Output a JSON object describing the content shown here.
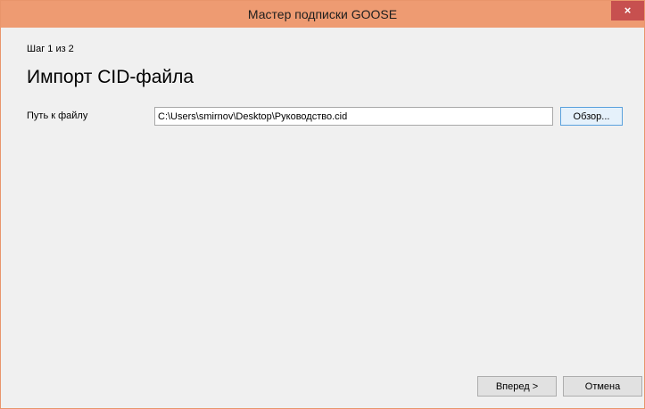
{
  "window": {
    "title": "Мастер подписки GOOSE",
    "close_glyph": "×"
  },
  "wizard": {
    "step": "Шаг 1 из 2",
    "heading": "Импорт CID-файла",
    "file_path_label": "Путь к файлу",
    "file_path_value": "C:\\Users\\smirnov\\Desktop\\Руководство.cid",
    "browse_label": "Обзор..."
  },
  "footer": {
    "next_label": "Вперед >",
    "cancel_label": "Отмена"
  },
  "colors": {
    "titlebar": "#ee9b72",
    "close_button": "#c7504f",
    "dialog_background": "#f0f0f0"
  }
}
